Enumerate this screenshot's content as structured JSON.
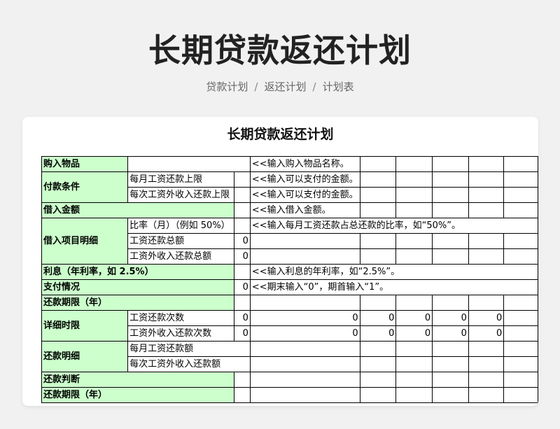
{
  "header": {
    "title": "长期贷款返还计划",
    "breadcrumb": [
      "贷款计划",
      "返还计划",
      "计划表"
    ]
  },
  "sheet": {
    "title": "长期贷款返还计划",
    "rows": {
      "item": {
        "label": "购入物品",
        "note": "<<输入购入物品名称。"
      },
      "payment": {
        "label": "付款条件",
        "sub1": "每月工资还款上限",
        "note1": "<<输入可以支付的金额。",
        "sub2": "每次工资外收入还款上限",
        "note2": "<<输入可以支付的金额。"
      },
      "borrow": {
        "label": "借入金额",
        "note": "<<输入借入金额。"
      },
      "detail": {
        "label": "借入项目明细",
        "sub1": "比率（月）（例如 50%）",
        "note1": "<<输入每月工资还款占总还款的比率，如“50%”。",
        "sub2": "工资还款总额",
        "val2": "0",
        "sub3": "工资外收入还款总额",
        "val3": "0"
      },
      "interest": {
        "label": "利息（年利率，如 2.5%）",
        "note": "<<输入利息的年利率，如“2.5%”。"
      },
      "payinfo": {
        "label": "支付情况",
        "val": "0",
        "note": "<<期末输入“0”，期首输入“1”。"
      },
      "term": {
        "label": "还款期限（年）"
      },
      "schedule": {
        "label": "详细时限",
        "sub1": "工资还款次数",
        "vals1": [
          "0",
          "0",
          "0",
          "0",
          "0",
          "0"
        ],
        "sub2": "工资外收入还款次数",
        "vals2": [
          "0",
          "0",
          "0",
          "0",
          "0",
          "0"
        ]
      },
      "repay": {
        "label": "还款明细",
        "sub1": "每月工资还款额",
        "sub2": "每次工资外收入还款额"
      },
      "judge": {
        "label": "还款判断"
      },
      "term2": {
        "label": "还款期限（年）"
      }
    }
  }
}
